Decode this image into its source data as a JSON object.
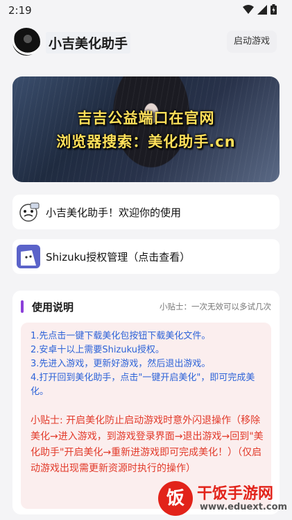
{
  "status_bar": {
    "time": "2:19"
  },
  "header": {
    "app_title": "小吉美化助手",
    "launch_button": "启动游戏"
  },
  "banner": {
    "line1": "吉吉公益端口在官网",
    "line2": "浏览器搜索：美化助手.cn"
  },
  "cards": [
    {
      "label": "小吉美化助手！欢迎你的使用",
      "icon": "sticker-icon"
    },
    {
      "label": "Shizuku授权管理（点击查看）",
      "icon": "shizuku-icon"
    }
  ],
  "instructions": {
    "title": "使用说明",
    "tip": "小贴士：一次无效可以多试几次",
    "steps": [
      "1.先点击一键下载美化包按钮下载美化文件。",
      "2.安卓十以上需要Shizuku授权。",
      "3.先进入游戏，更新好游戏，然后退出游戏。",
      "4.打开回到美化助手，点击\"一键开启美化\"，即可完成美化。"
    ],
    "warning": "小贴士: 开启美化防止启动游戏时意外闪退操作（移除美化→进入游戏，到游戏登录界面→退出游戏→回到\"美化助手\"开启美化→重新进游戏即可完成美化！）（仅启动游戏出现需更新资源时执行的操作）"
  },
  "watermark": {
    "logo_char": "饭",
    "name": "干饭手游网",
    "url": "www.eduext.com"
  },
  "colors": {
    "accent": "#8b3fd9",
    "steps_text": "#2d63d8",
    "warning_text": "#e23a2a",
    "banner_text": "#ffe05a"
  }
}
